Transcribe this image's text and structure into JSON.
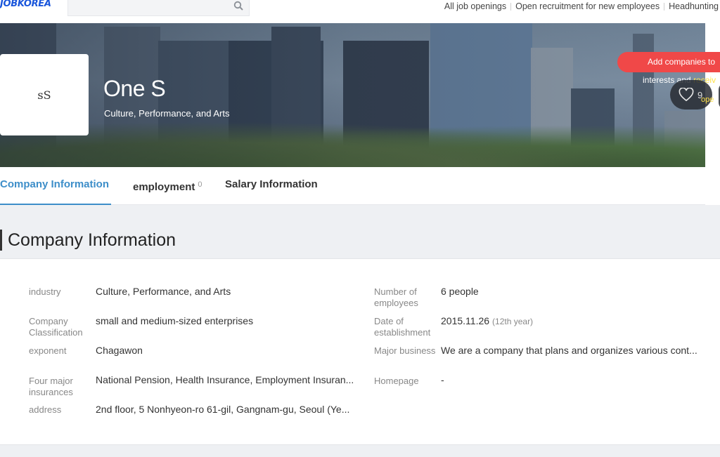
{
  "brand": {
    "logo": "JOBKOREA",
    "accent": "#3d8ec9"
  },
  "search": {
    "placeholder": "",
    "icon": "search-icon"
  },
  "topnav": {
    "items": [
      "All job openings",
      "Open recruitment for new employees",
      "Headhunting"
    ]
  },
  "banner": {
    "company_name": "One S",
    "industry": "Culture, Performance, and Arts",
    "logo_mark": "ꜱS",
    "tooltip": {
      "line1": "Add companies to",
      "line2_pre": "interests and",
      "line2_hl": "receiv",
      "line3": "ope"
    },
    "favorites_count": "9"
  },
  "tabs": [
    {
      "label": "Company Information",
      "active": true
    },
    {
      "label": "employment",
      "count": "0"
    },
    {
      "label": "Salary Information"
    }
  ],
  "section": {
    "title": "Company Information"
  },
  "info": {
    "left": [
      {
        "label": "industry",
        "value": "Culture, Performance, and Arts"
      },
      {
        "label": "Company Classification",
        "value": "small and medium-sized enterprises"
      },
      {
        "label": "exponent",
        "value": "Chagawon"
      },
      {
        "label": "Four major insurances",
        "value": "National Pension, Health Insurance, Employment Insuran..."
      },
      {
        "label": "address",
        "value": "2nd floor, 5 Nonhyeon-ro 61-gil, Gangnam-gu, Seoul (Ye..."
      }
    ],
    "right": [
      {
        "label": "Number of employees",
        "value": "6 people"
      },
      {
        "label": "Date of establishment",
        "value": "2015.11.26",
        "sub": "(12th year)"
      },
      {
        "label": "Major business",
        "value": "We are a company that plans and organizes various cont..."
      },
      {
        "label": "Homepage",
        "value": "-"
      }
    ]
  }
}
